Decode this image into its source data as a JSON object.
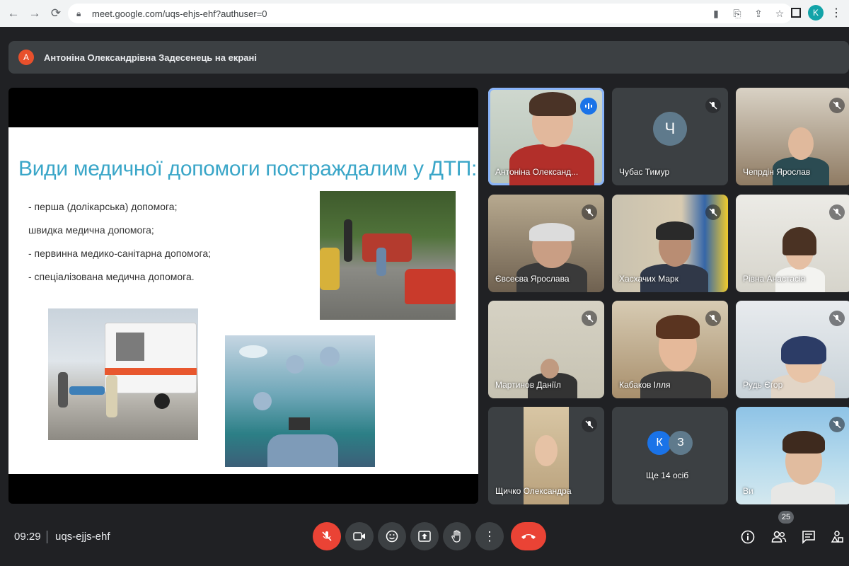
{
  "browser": {
    "url": "meet.google.com/uqs-ehjs-ehf?authuser=0",
    "profile_initial": "K"
  },
  "banner": {
    "avatar_initial": "А",
    "text": "Антоніна Олександрівна Задесенець на екрані"
  },
  "slide": {
    "title": "Види медичної допомоги постраждалим у ДТП:",
    "bullets": [
      "- перша (долікарська) допомога;",
      "  швидка медична допомога;",
      "- первинна медико-санітарна допомога;",
      "- спеціалізована медична допомога."
    ]
  },
  "participants": [
    {
      "name": "Антоніна Олександ...",
      "speaking": true
    },
    {
      "name": "Чубас Тимур",
      "initial": "Ч",
      "muted": true
    },
    {
      "name": "Чепрдін Ярослав",
      "muted": true
    },
    {
      "name": "Євсеєва Ярослава",
      "muted": true
    },
    {
      "name": "Хасхачих Марк",
      "muted": true
    },
    {
      "name": "Рівна Анастасія",
      "muted": true
    },
    {
      "name": "Мартинов Даніїл",
      "muted": true
    },
    {
      "name": "Кабаков Ілля",
      "muted": true
    },
    {
      "name": "Рудь Єгор",
      "muted": true
    },
    {
      "name": "Щичко Олександра",
      "muted": true
    },
    {
      "name": "Ще 14 осіб",
      "initials": [
        "К",
        "З"
      ]
    },
    {
      "name": "Ви",
      "muted": true
    }
  ],
  "meeting": {
    "time": "09:29",
    "code": "uqs-ejjs-ehf",
    "participant_count": "25"
  },
  "colors": {
    "accent_blue": "#1a73e8",
    "end_call_red": "#ea4335",
    "tile_bg": "#3c4043",
    "page_bg": "#202124"
  }
}
